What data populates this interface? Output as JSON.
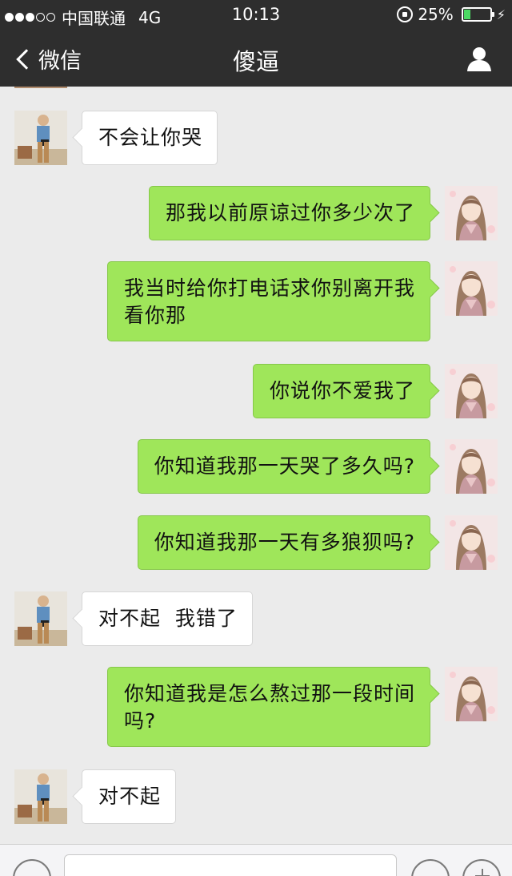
{
  "status_bar": {
    "carrier": "中国联通",
    "network": "4G",
    "time": "10:13",
    "battery": "25%",
    "battery_level": 0.25,
    "signal_bars": 3,
    "signal_total": 5
  },
  "nav": {
    "back_label": "微信",
    "title": "傻逼",
    "profile_icon": "person-icon"
  },
  "colors": {
    "bar_bg": "#2e2e2e",
    "chat_bg": "#ebebeb",
    "sent_bubble": "#9fe65a",
    "received_bubble": "#ffffff"
  },
  "messages": [
    {
      "side": "left",
      "text": "不会让你哭"
    },
    {
      "side": "right",
      "text": "那我以前原谅过你多少次了"
    },
    {
      "side": "right",
      "text": "我当时给你打电话求你别离开我\n看你那"
    },
    {
      "side": "right",
      "text": "你说你不爱我了"
    },
    {
      "side": "right",
      "text": "你知道我那一天哭了多久吗?"
    },
    {
      "side": "right",
      "text": "你知道我那一天有多狼狈吗?"
    },
    {
      "side": "left",
      "text": "对不起  我错了"
    },
    {
      "side": "right",
      "text": "你知道我是怎么熬过那一段时间\n吗?"
    },
    {
      "side": "left",
      "text": "对不起"
    }
  ]
}
